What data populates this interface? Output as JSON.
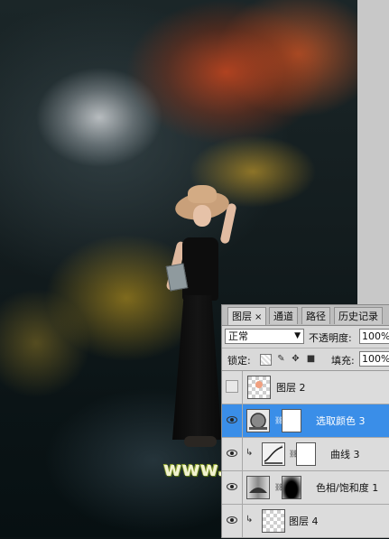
{
  "watermark": "www.68ps.com",
  "panel": {
    "tabs": [
      {
        "label": "图层",
        "close": "×"
      },
      {
        "label": "通道"
      },
      {
        "label": "路径"
      },
      {
        "label": "历史记录"
      }
    ],
    "blend_mode": "正常",
    "opacity_label": "不透明度:",
    "opacity_value": "100%",
    "lock_label": "锁定:",
    "fill_label": "填充:",
    "fill_value": "100%",
    "layers": [
      {
        "name": "图层 2",
        "visible": false,
        "selected": false
      },
      {
        "name": "选取颜色 3",
        "visible": true,
        "selected": true
      },
      {
        "name": "曲线 3",
        "visible": true,
        "selected": false
      },
      {
        "name": "色相/饱和度 1",
        "visible": true,
        "selected": false
      },
      {
        "name": "图层 4",
        "visible": true,
        "selected": false
      }
    ]
  },
  "colors": {
    "selection": "#3a8ee8",
    "panel_bg": "#d9d9d9"
  }
}
